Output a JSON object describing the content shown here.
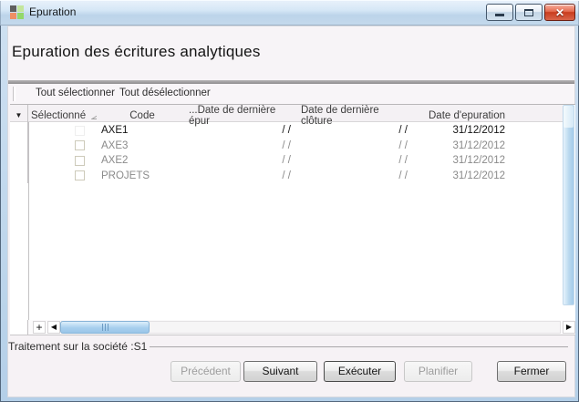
{
  "window": {
    "title": "Epuration",
    "controls": {
      "minimize_icon": "minimize",
      "maximize_icon": "maximize",
      "close_icon": "✕"
    }
  },
  "heading": {
    "title": "Epuration des écritures analytiques"
  },
  "toolbar": {
    "select_all_label": "Tout sélectionner",
    "deselect_all_label": "Tout désélectionner"
  },
  "grid": {
    "gutter_arrow": "▼",
    "header": {
      "selected": "Sélectionné",
      "code": "Code",
      "last_purge": "...Date de dernière épur",
      "last_close": "Date de dernière clôture",
      "purge_date": "Date d'epuration"
    },
    "rows": [
      {
        "checked": false,
        "highlighted": true,
        "code": "AXE1",
        "last_purge": "/  /",
        "last_close": "/  /",
        "purge_date": "31/12/2012"
      },
      {
        "checked": false,
        "highlighted": false,
        "code": "AXE3",
        "last_purge": "/  /",
        "last_close": "/  /",
        "purge_date": "31/12/2012"
      },
      {
        "checked": false,
        "highlighted": false,
        "code": "AXE2",
        "last_purge": "/  /",
        "last_close": "/  /",
        "purge_date": "31/12/2012"
      },
      {
        "checked": false,
        "highlighted": false,
        "code": "PROJETS",
        "last_purge": "/  /",
        "last_close": "/  /",
        "purge_date": "31/12/2012"
      }
    ]
  },
  "scrollbars": {
    "add_button": "+",
    "left_arrow": "◀",
    "right_arrow": "▶"
  },
  "status": {
    "label": "Traitement sur la société :S1"
  },
  "footer": {
    "buttons": [
      {
        "label": "Précédent",
        "enabled": false
      },
      {
        "label": "Suivant",
        "enabled": true
      },
      {
        "label": "Exécuter",
        "enabled": true
      },
      {
        "label": "Planifier",
        "enabled": false
      },
      {
        "label": "Fermer",
        "enabled": true
      }
    ]
  },
  "colors": {
    "titlebar_blue": "#c9dcef",
    "close_red": "#c93c1d",
    "row_highlight": "#b5b3b5",
    "scrollbar_blue": "#9ac6e9",
    "client_bg": "#f6f2f5"
  }
}
